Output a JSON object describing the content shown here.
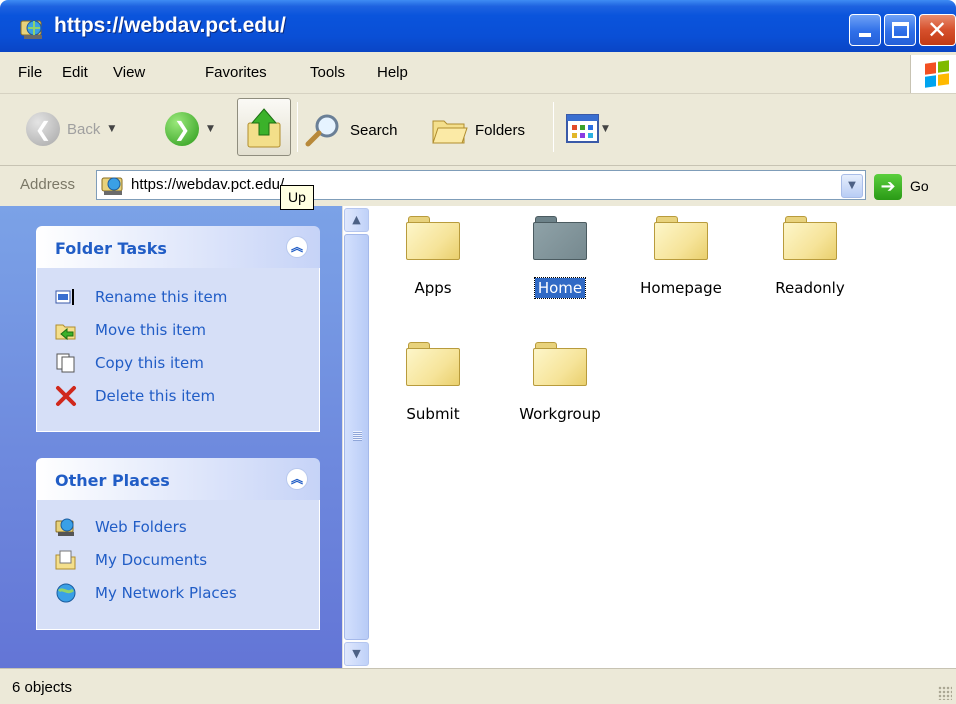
{
  "window": {
    "title": "https://webdav.pct.edu/",
    "title_icon": "network-globe-icon"
  },
  "menu": {
    "items": [
      "File",
      "Edit",
      "View",
      "Favorites",
      "Tools",
      "Help"
    ]
  },
  "toolbar": {
    "back_label": "Back",
    "search_label": "Search",
    "folders_label": "Folders",
    "up_tooltip": "Up"
  },
  "address": {
    "label": "Address",
    "value": "https://webdav.pct.edu/",
    "go_label": "Go"
  },
  "tasks_panel": {
    "title": "Folder Tasks",
    "items": [
      {
        "label": "Rename this item",
        "icon": "rename-icon"
      },
      {
        "label": "Move this item",
        "icon": "move-folder-icon"
      },
      {
        "label": "Copy this item",
        "icon": "copy-icon"
      },
      {
        "label": "Delete this item",
        "icon": "delete-x-icon"
      }
    ]
  },
  "places_panel": {
    "title": "Other Places",
    "items": [
      {
        "label": "Web Folders",
        "icon": "web-folders-icon"
      },
      {
        "label": "My Documents",
        "icon": "my-documents-icon"
      },
      {
        "label": "My Network Places",
        "icon": "network-places-icon"
      }
    ]
  },
  "files": [
    {
      "name": "Apps",
      "selected": false
    },
    {
      "name": "Home",
      "selected": true
    },
    {
      "name": "Homepage",
      "selected": false
    },
    {
      "name": "Readonly",
      "selected": false
    },
    {
      "name": "Submit",
      "selected": false
    },
    {
      "name": "Workgroup",
      "selected": false
    }
  ],
  "status": {
    "text": "6 objects"
  },
  "colors": {
    "titlebar": "#0a54dc",
    "taskpane": "#6f8fe0",
    "link": "#215dc6",
    "selection": "#316ac5"
  }
}
